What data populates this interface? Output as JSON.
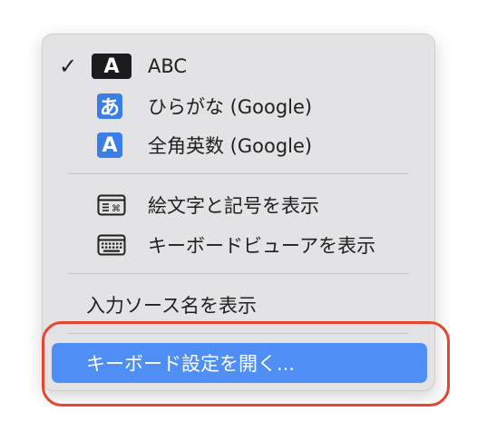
{
  "menu": {
    "items": [
      {
        "label": "ABC",
        "checked": true,
        "icon": "abc-input-icon",
        "icon_text": "A"
      },
      {
        "label": "ひらがな (Google)",
        "checked": false,
        "icon": "hiragana-input-icon",
        "icon_text": "あ"
      },
      {
        "label": "全角英数 (Google)",
        "checked": false,
        "icon": "fullwidth-alpha-input-icon",
        "icon_text": "A"
      }
    ],
    "tools": [
      {
        "label": "絵文字と記号を表示",
        "icon": "emoji-symbols-icon"
      },
      {
        "label": "キーボードビューアを表示",
        "icon": "keyboard-viewer-icon"
      }
    ],
    "show_input_source_name": "入力ソース名を表示",
    "open_keyboard_settings": "キーボード設定を開く..."
  },
  "colors": {
    "highlight": "#4f8ff5",
    "annotation_ring": "#e8452f",
    "menu_background": "#e3e3e5",
    "input_icon_blue": "#3b7ee6"
  }
}
